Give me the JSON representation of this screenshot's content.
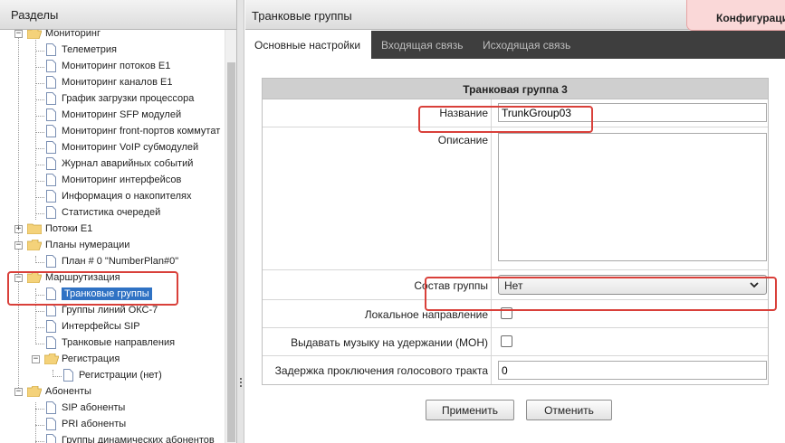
{
  "sections_header": "Разделы",
  "page_title": "Транковые группы",
  "config_label": "Конфигурация",
  "tabs": [
    "Основные настройки",
    "Входящая связь",
    "Исходящая связь"
  ],
  "tree": {
    "monitoring": "Мониторинг",
    "monitoring_items": [
      "Телеметрия",
      "Мониторинг потоков E1",
      "Мониторинг каналов E1",
      "График загрузки процессора",
      "Мониторинг SFP модулей",
      "Мониторинг front-портов коммутат",
      "Мониторинг VoIP субмодулей",
      "Журнал аварийных событий",
      "Мониторинг интерфейсов",
      "Информация о накопителях",
      "Статистика очередей"
    ],
    "e1_streams": "Потоки E1",
    "numbering_plans": "Планы нумерации",
    "numbering_plan_item": "План # 0 \"NumberPlan#0\"",
    "routing": "Маршрутизация",
    "routing_items": [
      "Транковые группы",
      "Группы линий ОКС-7",
      "Интерфейсы SIP",
      "Транковые направления"
    ],
    "registration": "Регистрация",
    "registration_item": "Регистрации (нет)",
    "subscribers": "Абоненты",
    "subscriber_items": [
      "SIP абоненты",
      "PRI абоненты",
      "Группы динамических абонентов"
    ]
  },
  "form": {
    "title": "Транковая группа 3",
    "name_label": "Название",
    "name_value": "TrunkGroup03",
    "description_label": "Описание",
    "description_value": "",
    "composition_label": "Состав группы",
    "composition_value": "Нет",
    "local_direction_label": "Локальное направление",
    "moh_label": "Выдавать музыку на удержании (МОН)",
    "delay_label": "Задержка проключения голосового тракта",
    "delay_value": "0"
  },
  "buttons": {
    "apply": "Применить",
    "cancel": "Отменить"
  },
  "colors": {
    "highlight": "#d9403a",
    "selected": "#2f72c4",
    "tab_bar": "#3e3e3e"
  }
}
